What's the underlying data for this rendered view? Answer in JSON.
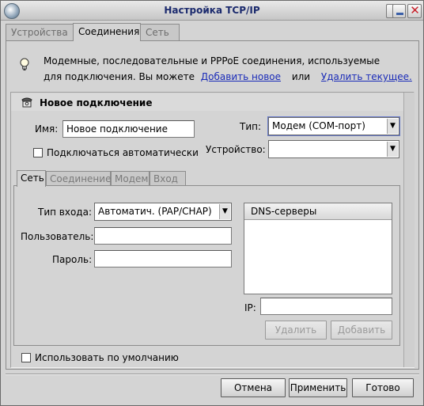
{
  "window": {
    "title": "Настройка TCP/IP"
  },
  "top_tabs": [
    {
      "label": "Устройства",
      "active": false
    },
    {
      "label": "Соединения",
      "active": true
    },
    {
      "label": "Сеть",
      "active": false
    }
  ],
  "info": {
    "line1": "Модемные, последовательные и PPPoE соединения, используемые",
    "line2_prefix": "для подключения. Вы можете",
    "add_link": "Добавить новое",
    "or_text": "или",
    "delete_link": "Удалить текущее."
  },
  "connection": {
    "title": "Новое подключение",
    "name_label": "Имя:",
    "name_value": "Новое подключение",
    "type_label": "Тип:",
    "type_value": "Модем (COM-порт)",
    "device_label": "Устройство:",
    "device_value": "",
    "auto_connect_label": "Подключаться автоматически",
    "auto_connect_checked": false
  },
  "inner_tabs": [
    {
      "label": "Сеть",
      "active": true
    },
    {
      "label": "Соединение",
      "active": false
    },
    {
      "label": "Модем",
      "active": false
    },
    {
      "label": "Вход",
      "active": false
    }
  ],
  "network": {
    "login_type_label": "Тип входа:",
    "login_type_value": "Автоматич. (PAP/CHAP)",
    "user_label": "Пользователь:",
    "user_value": "",
    "password_label": "Пароль:",
    "password_value": "",
    "dns_header": "DNS-серверы",
    "dns_items": [],
    "ip_label": "IP:",
    "ip_value": "",
    "delete_button": "Удалить",
    "add_button": "Добавить"
  },
  "use_default_label": "Использовать по умолчанию",
  "use_default_checked": false,
  "footer": {
    "cancel": "Отмена",
    "apply": "Применить",
    "done": "Готово"
  },
  "colors": {
    "title_text": "#1c2b6e",
    "link": "#1a2bb8",
    "close_icon": "#c8202a"
  },
  "icons": {
    "app": "network-globe-icon",
    "info": "lightbulb-icon",
    "connection": "telephone-icon",
    "combo_arrow": "triangle-down-icon"
  }
}
